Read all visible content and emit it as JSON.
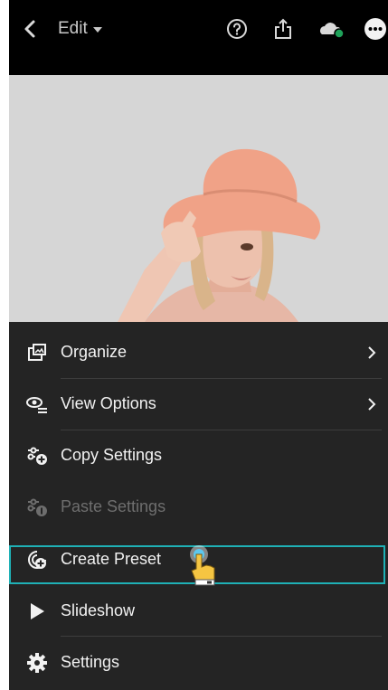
{
  "header": {
    "edit_label": "Edit",
    "icons": [
      "back-icon",
      "help-icon",
      "share-icon",
      "cloud-sync-icon",
      "more-icon"
    ],
    "sync_dot_color": "#1fa25a"
  },
  "menu": {
    "items": [
      {
        "label": "Organize",
        "icon": "organize-icon",
        "has_submenu": true,
        "enabled": true
      },
      {
        "label": "View Options",
        "icon": "view-options-icon",
        "has_submenu": true,
        "enabled": true
      },
      {
        "label": "Copy Settings",
        "icon": "copy-settings-icon",
        "has_submenu": false,
        "enabled": true
      },
      {
        "label": "Paste Settings",
        "icon": "paste-settings-icon",
        "has_submenu": false,
        "enabled": false
      },
      {
        "label": "Create Preset",
        "icon": "create-preset-icon",
        "has_submenu": false,
        "enabled": true,
        "highlighted": true
      },
      {
        "label": "Slideshow",
        "icon": "play-icon",
        "has_submenu": false,
        "enabled": true
      },
      {
        "label": "Settings",
        "icon": "gear-icon",
        "has_submenu": false,
        "enabled": true
      }
    ]
  },
  "colors": {
    "topbar": "#000000",
    "menu_background": "#242424",
    "highlight": "#1fb1b6",
    "text": "#f2f2f2",
    "disabled_text": "#6e6e6e"
  }
}
